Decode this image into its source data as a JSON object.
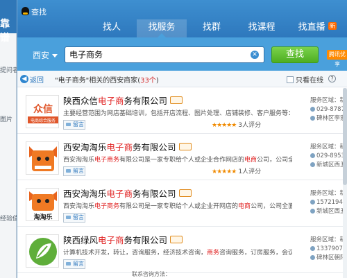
{
  "background_window": {
    "title_fragment": "靠谱",
    "left_texts": [
      "提问者",
      "图片",
      "经验值"
    ]
  },
  "window": {
    "title": "查找"
  },
  "tabs": [
    {
      "label": "找人",
      "active": false
    },
    {
      "label": "找服务",
      "active": true
    },
    {
      "label": "找群",
      "active": false
    },
    {
      "label": "找课程",
      "active": false
    },
    {
      "label": "找直播",
      "active": false,
      "badge": "新"
    }
  ],
  "search": {
    "city": "西安",
    "query": "电子商务",
    "button": "查找",
    "promo": "腾讯优享"
  },
  "result_bar": {
    "back": "返回",
    "desc_prefix": "\"电子商务\"相关的西安商家(",
    "count": "33个",
    "desc_suffix": ")",
    "online_only": "只看在线"
  },
  "results": [
    {
      "name_pre": "陕西众",
      "name_mid1": "",
      "name": "陕西众信电子商务有限公司",
      "name_parts": [
        "陕西众信",
        "电子商",
        "务有限公司"
      ],
      "desc_parts": [
        "主要经营范围为网店基础培训，包括开店流程、图片处理、店铺装修、客户服务等：网店教..."
      ],
      "stars": "★★★★★",
      "reviews": "3人评分",
      "msg": "留言",
      "right": [
        "服务区域：新",
        "029-8787",
        "碑林区李家"
      ],
      "logo_text": "众信",
      "logo_sub": "电商综合服务"
    },
    {
      "name_parts": [
        "西安淘淘乐",
        "电子商",
        "务有限公司"
      ],
      "desc_parts": [
        "西安淘淘乐",
        "电子商务",
        "有限公司是一家专职给个人或企业合作网店的",
        "电商",
        "公司，公司全面整合..."
      ],
      "stars": "★★★★★",
      "reviews": "1人评分",
      "msg": "留言",
      "right": [
        "服务区域：新",
        "029-8953",
        "新城区西五"
      ]
    },
    {
      "name_parts": [
        "西安淘淘乐",
        "电子商",
        "务有限公司"
      ],
      "desc_parts": [
        "西安淘淘乐",
        "电子商务",
        "有限公司是一家专职给个人或企业开网店的",
        "电商",
        "公司，公司全面整合厂..."
      ],
      "stars": "",
      "reviews": "",
      "msg": "留言",
      "right": [
        "服务区域：新",
        "1572194",
        "新城区西五"
      ],
      "logo_text": "淘淘乐"
    },
    {
      "name_parts": [
        "陕西绿风",
        "电子商",
        "务有限公司"
      ],
      "desc_parts": [
        "计算机技术开发，转让，咨询服务，经济技术咨询，",
        "商务",
        "咨询服务，订房服务，会议服务..."
      ],
      "stars": "",
      "reviews": "",
      "msg": "留言",
      "right": [
        "服务区域：新",
        "1337907",
        "碑林区朝阳"
      ]
    }
  ],
  "bottom_peek": "联系咨询方法："
}
